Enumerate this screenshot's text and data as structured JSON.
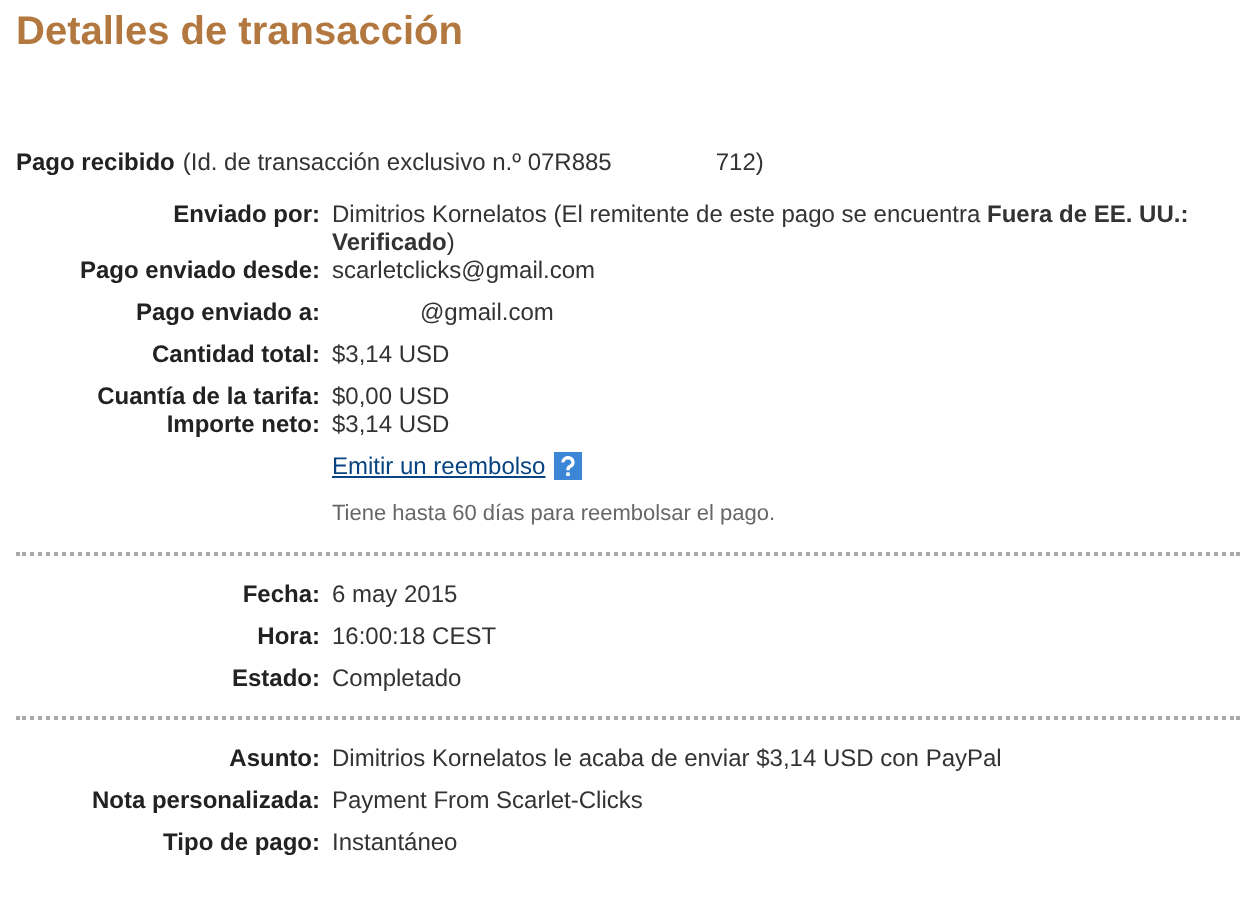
{
  "title": "Detalles de transacción",
  "header": {
    "label": "Pago recibido",
    "detail": "(Id. de transacción exclusivo n.º 07R885",
    "detail_tail": "712)"
  },
  "sections": [
    {
      "groups": [
        [
          {
            "label": "Enviado por:",
            "value": "Dimitrios Kornelatos (El remitente de este pago se encuentra **Fuera de EE. UU.: Verificado**)"
          },
          {
            "label": "Pago enviado desde:",
            "value": "scarletclicks@gmail.com"
          }
        ],
        [
          {
            "label": "Pago enviado a:",
            "value": "@gmail.com",
            "kind": "redacted"
          }
        ],
        [
          {
            "label": "Cantidad total:",
            "value": "$3,14 USD"
          }
        ],
        [
          {
            "label": "Cuantía de la tarifa:",
            "value": "$0,00 USD"
          },
          {
            "label": "Importe neto:",
            "value": "$3,14 USD"
          }
        ]
      ],
      "link": "Emitir un reembolso",
      "note": "Tiene hasta 60 días para reembolsar el pago."
    },
    {
      "groups": [
        [
          {
            "label": "Fecha:",
            "value": "6 may 2015"
          }
        ],
        [
          {
            "label": "Hora:",
            "value": "16:00:18 CEST"
          }
        ],
        [
          {
            "label": "Estado:",
            "value": "Completado"
          }
        ]
      ]
    },
    {
      "groups": [
        [
          {
            "label": "Asunto:",
            "value": "Dimitrios Kornelatos le acaba de enviar $3,14 USD con PayPal"
          }
        ],
        [
          {
            "label": "Nota personalizada:",
            "value": "Payment From Scarlet-Clicks"
          }
        ],
        [
          {
            "label": "Tipo de pago:",
            "value": "Instantáneo"
          }
        ]
      ]
    }
  ]
}
